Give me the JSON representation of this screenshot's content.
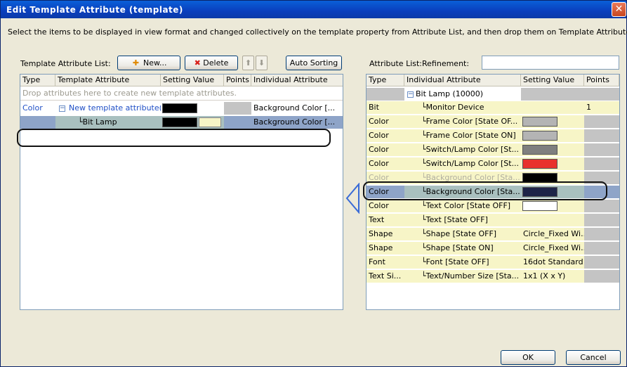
{
  "window": {
    "title": "Edit Template Attribute (template)",
    "close_glyph": "✕"
  },
  "instruction": "Select the items to be displayed in view format and changed collectively on the template property from Attribute List, and then drop them on Template Attribute List.",
  "left": {
    "label": "Template Attribute List:",
    "new_button": "New...",
    "delete_button": "Delete",
    "up_glyph": "⬆",
    "down_glyph": "⬇",
    "auto_sort_button": "Auto Sorting",
    "columns": [
      "Type",
      "Template Attribute",
      "Setting Value",
      "Points",
      "Individual Attribute"
    ],
    "drop_hint": "Drop attributes here to create new template attributes.",
    "row1": {
      "type": "Color",
      "attr": "New template attribute(...",
      "individual": "Background Color [..."
    },
    "row2": {
      "attr": "Bit Lamp",
      "individual": "Background Color [..."
    }
  },
  "right": {
    "label": "Attribute List:",
    "refinement_label": "Refinement:",
    "refinement_value": "",
    "columns": [
      "Type",
      "Individual Attribute",
      "Setting Value",
      "Points"
    ],
    "root": "Bit Lamp (10000)",
    "rows": [
      {
        "type": "Bit",
        "attr": "Monitor Device",
        "value": "",
        "points": "1"
      },
      {
        "type": "Color",
        "attr": "Frame Color [State OF...",
        "value": "",
        "points": ""
      },
      {
        "type": "Color",
        "attr": "Frame Color [State ON]",
        "value": "",
        "points": ""
      },
      {
        "type": "Color",
        "attr": "Switch/Lamp Color [St...",
        "value": "",
        "points": ""
      },
      {
        "type": "Color",
        "attr": "Switch/Lamp Color [St...",
        "value": "",
        "points": ""
      },
      {
        "type": "Color",
        "attr": "Background Color [Sta...",
        "value": "",
        "points": ""
      },
      {
        "type": "Color",
        "attr": "Background Color [Sta...",
        "value": "",
        "points": ""
      },
      {
        "type": "Color",
        "attr": "Text Color [State OFF]",
        "value": "",
        "points": ""
      },
      {
        "type": "Text",
        "attr": "Text [State OFF]",
        "value": "",
        "points": ""
      },
      {
        "type": "Shape",
        "attr": "Shape [State OFF]",
        "value": "Circle_Fixed Wi...",
        "points": ""
      },
      {
        "type": "Shape",
        "attr": "Shape [State ON]",
        "value": "Circle_Fixed Wi...",
        "points": ""
      },
      {
        "type": "Font",
        "attr": "Font [State OFF]",
        "value": "16dot Standard",
        "points": ""
      },
      {
        "type": "Text Si...",
        "attr": "Text/Number Size [Sta...",
        "value": "1x1 (X x Y)",
        "points": ""
      }
    ]
  },
  "buttons": {
    "ok": "OK",
    "cancel": "Cancel"
  },
  "colors": {
    "swatch_frame_off": "#b4b4b4",
    "swatch_frame_on": "#b4b4b4",
    "swatch_lamp_1": "#7f7f7f",
    "swatch_lamp_2": "#e8322c",
    "swatch_bg_1": "#000000",
    "swatch_bg_2": "#1e2448",
    "swatch_text": "#ffffff",
    "accent": "#3a6bd6"
  }
}
